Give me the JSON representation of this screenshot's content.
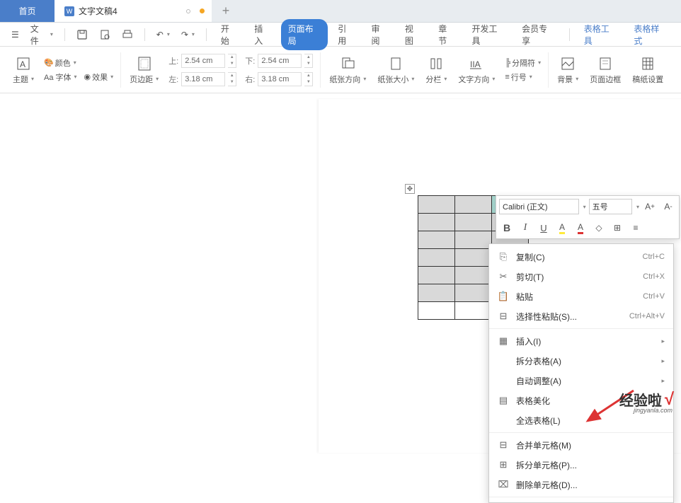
{
  "tabs": {
    "home": "首页",
    "doc": "文字文稿4"
  },
  "file_menu": "文件",
  "menu": {
    "start": "开始",
    "insert": "插入",
    "layout": "页面布局",
    "reference": "引用",
    "review": "审阅",
    "view": "视图",
    "chapter": "章节",
    "devtools": "开发工具",
    "member": "会员专享",
    "table_tools": "表格工具",
    "table_style": "表格样式"
  },
  "ribbon": {
    "theme": "主题",
    "font": "Aa 字体",
    "effect": "效果",
    "color": "颜色",
    "margin": "页边距",
    "top_label": "上:",
    "top_val": "2.54 cm",
    "bottom_label": "下:",
    "bottom_val": "2.54 cm",
    "left_label": "左:",
    "left_val": "3.18 cm",
    "right_label": "右:",
    "right_val": "3.18 cm",
    "orient": "纸张方向",
    "size": "纸张大小",
    "columns": "分栏",
    "textdir": "文字方向",
    "breaks": "分隔符",
    "lineno": "行号",
    "bg": "背景",
    "border": "页面边框",
    "manuscript": "稿纸设置"
  },
  "mini": {
    "font_name": "Calibri (正文)",
    "font_size": "五号"
  },
  "ctx": {
    "copy": "复制(C)",
    "copy_sc": "Ctrl+C",
    "cut": "剪切(T)",
    "cut_sc": "Ctrl+X",
    "paste": "粘贴",
    "paste_sc": "Ctrl+V",
    "paste_special": "选择性粘贴(S)...",
    "paste_special_sc": "Ctrl+Alt+V",
    "insert": "插入(I)",
    "split_table": "拆分表格(A)",
    "auto_adjust": "自动调整(A)",
    "beautify": "表格美化",
    "select_all": "全选表格(L)",
    "merge": "合并单元格(M)",
    "split_cell": "拆分单元格(P)...",
    "delete_cell": "删除单元格(D)..."
  },
  "watermark": {
    "text": "经验啦",
    "sub": "jingyanla.com"
  }
}
